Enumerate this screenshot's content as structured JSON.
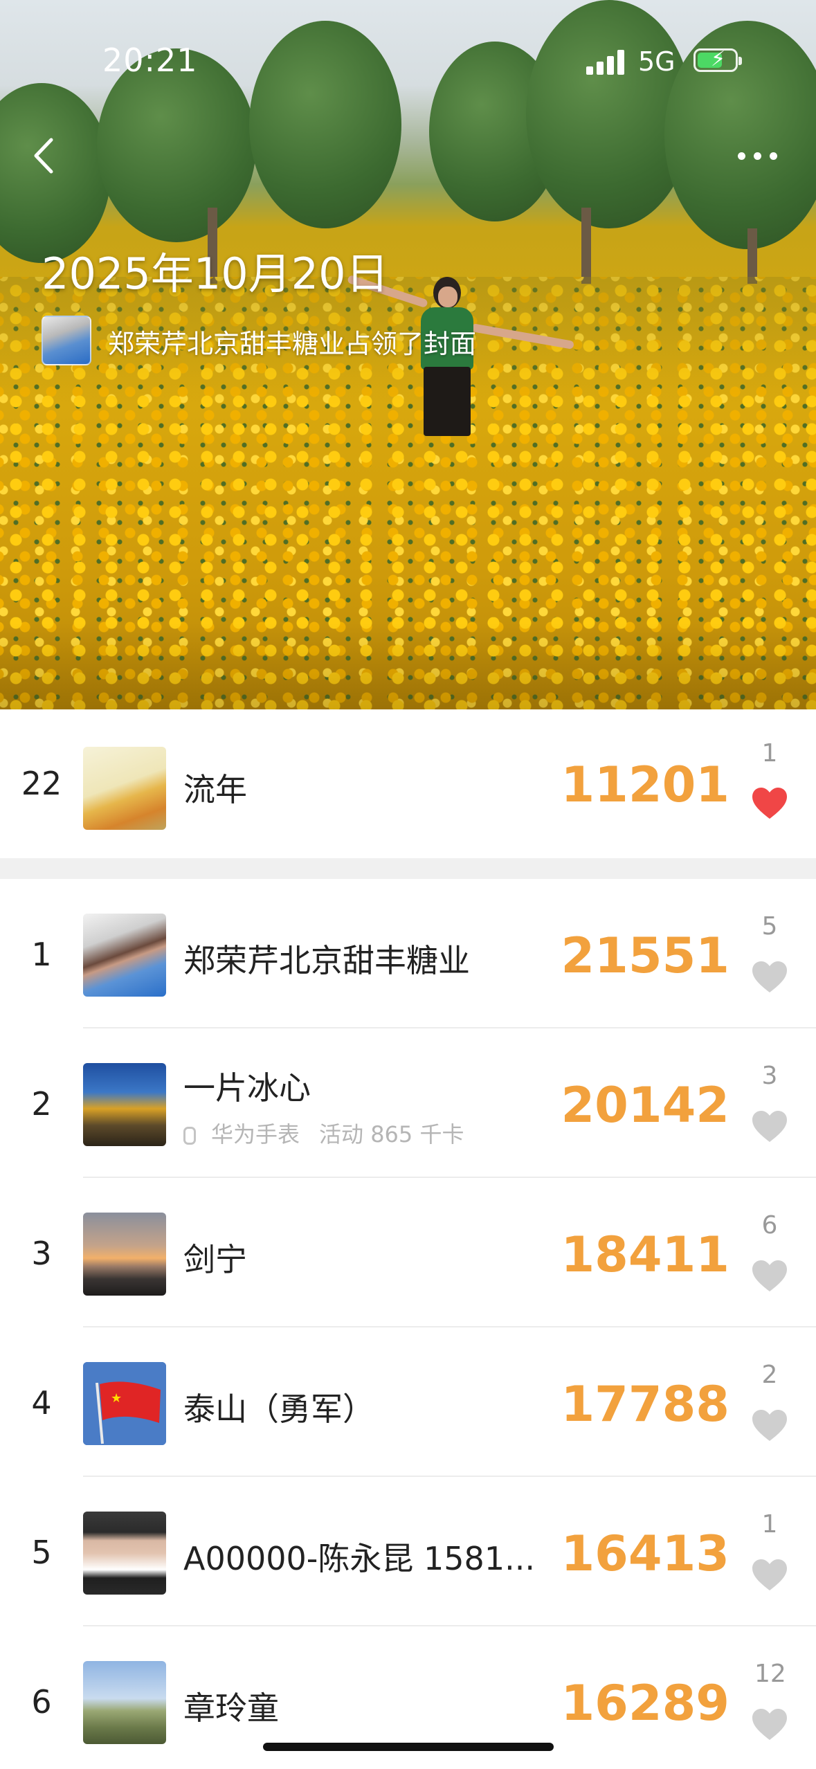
{
  "status": {
    "time": "20:21",
    "network": "5G"
  },
  "cover": {
    "date": "2025年10月20日",
    "owner_text": "郑荣芹北京甜丰糖业占领了封面"
  },
  "my_entry": {
    "rank": "22",
    "name": "流年",
    "steps": "11201",
    "likes": "1",
    "liked": true
  },
  "ranking": [
    {
      "rank": "1",
      "name": "郑荣芹北京甜丰糖业",
      "steps": "21551",
      "likes": "5"
    },
    {
      "rank": "2",
      "name": "一片冰心",
      "device": "华为手表",
      "activity": "活动 865 千卡",
      "steps": "20142",
      "likes": "3"
    },
    {
      "rank": "3",
      "name": "剑宁",
      "steps": "18411",
      "likes": "6"
    },
    {
      "rank": "4",
      "name": "泰山（勇军）",
      "steps": "17788",
      "likes": "2"
    },
    {
      "rank": "5",
      "name": "A00000-陈永昆 1581...",
      "steps": "16413",
      "likes": "1"
    },
    {
      "rank": "6",
      "name": "章玲童",
      "steps": "16289",
      "likes": "12"
    }
  ],
  "colors": {
    "steps": "#f2a13d",
    "liked_heart": "#f04646",
    "heart": "#cfcfcf",
    "separator": "#f0f0f0"
  },
  "icons": [
    "back-icon",
    "more-icon",
    "heart-icon",
    "watch-icon",
    "signal-icon",
    "battery-icon"
  ]
}
